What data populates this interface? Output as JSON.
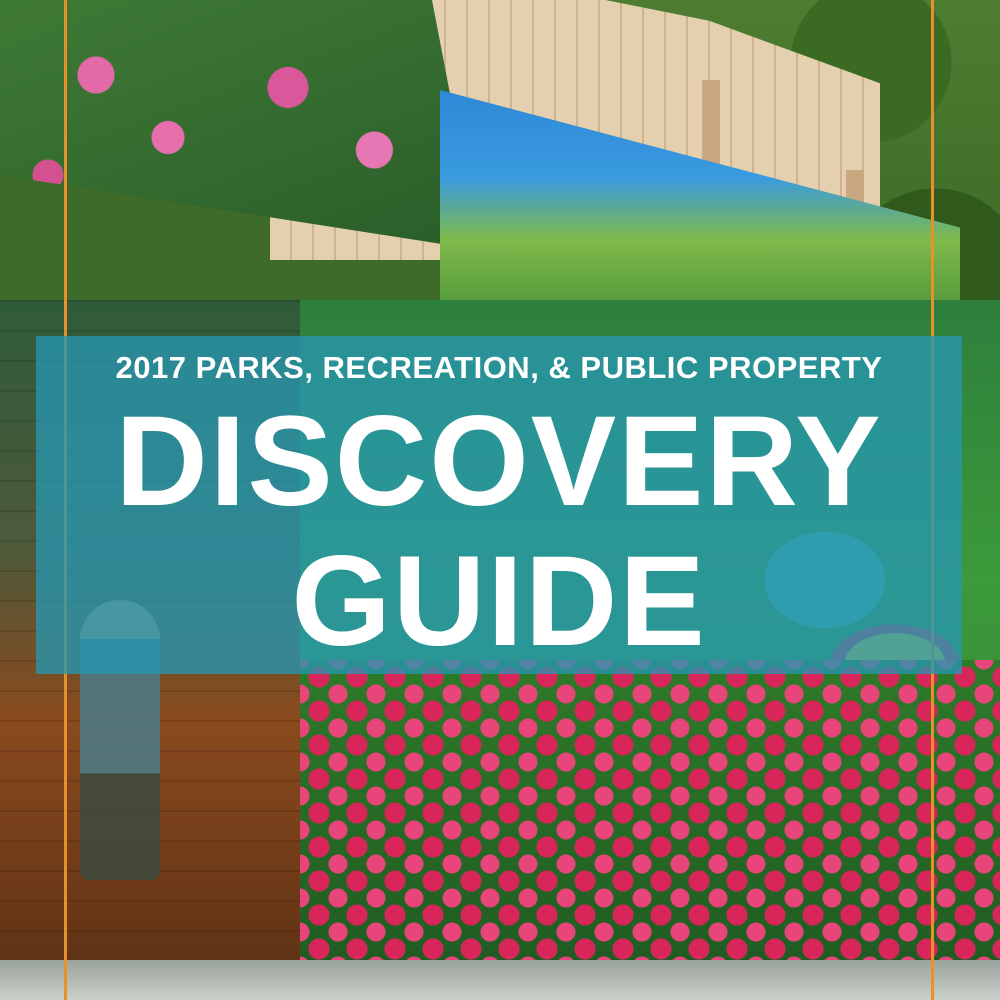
{
  "banner": {
    "subtitle": "2017 PARKS, RECREATION, & PUBLIC PROPERTY",
    "title_line1": "DISCOVERY",
    "title_line2": "GUIDE"
  },
  "colors": {
    "banner_overlay": "#2696b0",
    "guide_lines": "#e8902a",
    "text": "#ffffff"
  }
}
